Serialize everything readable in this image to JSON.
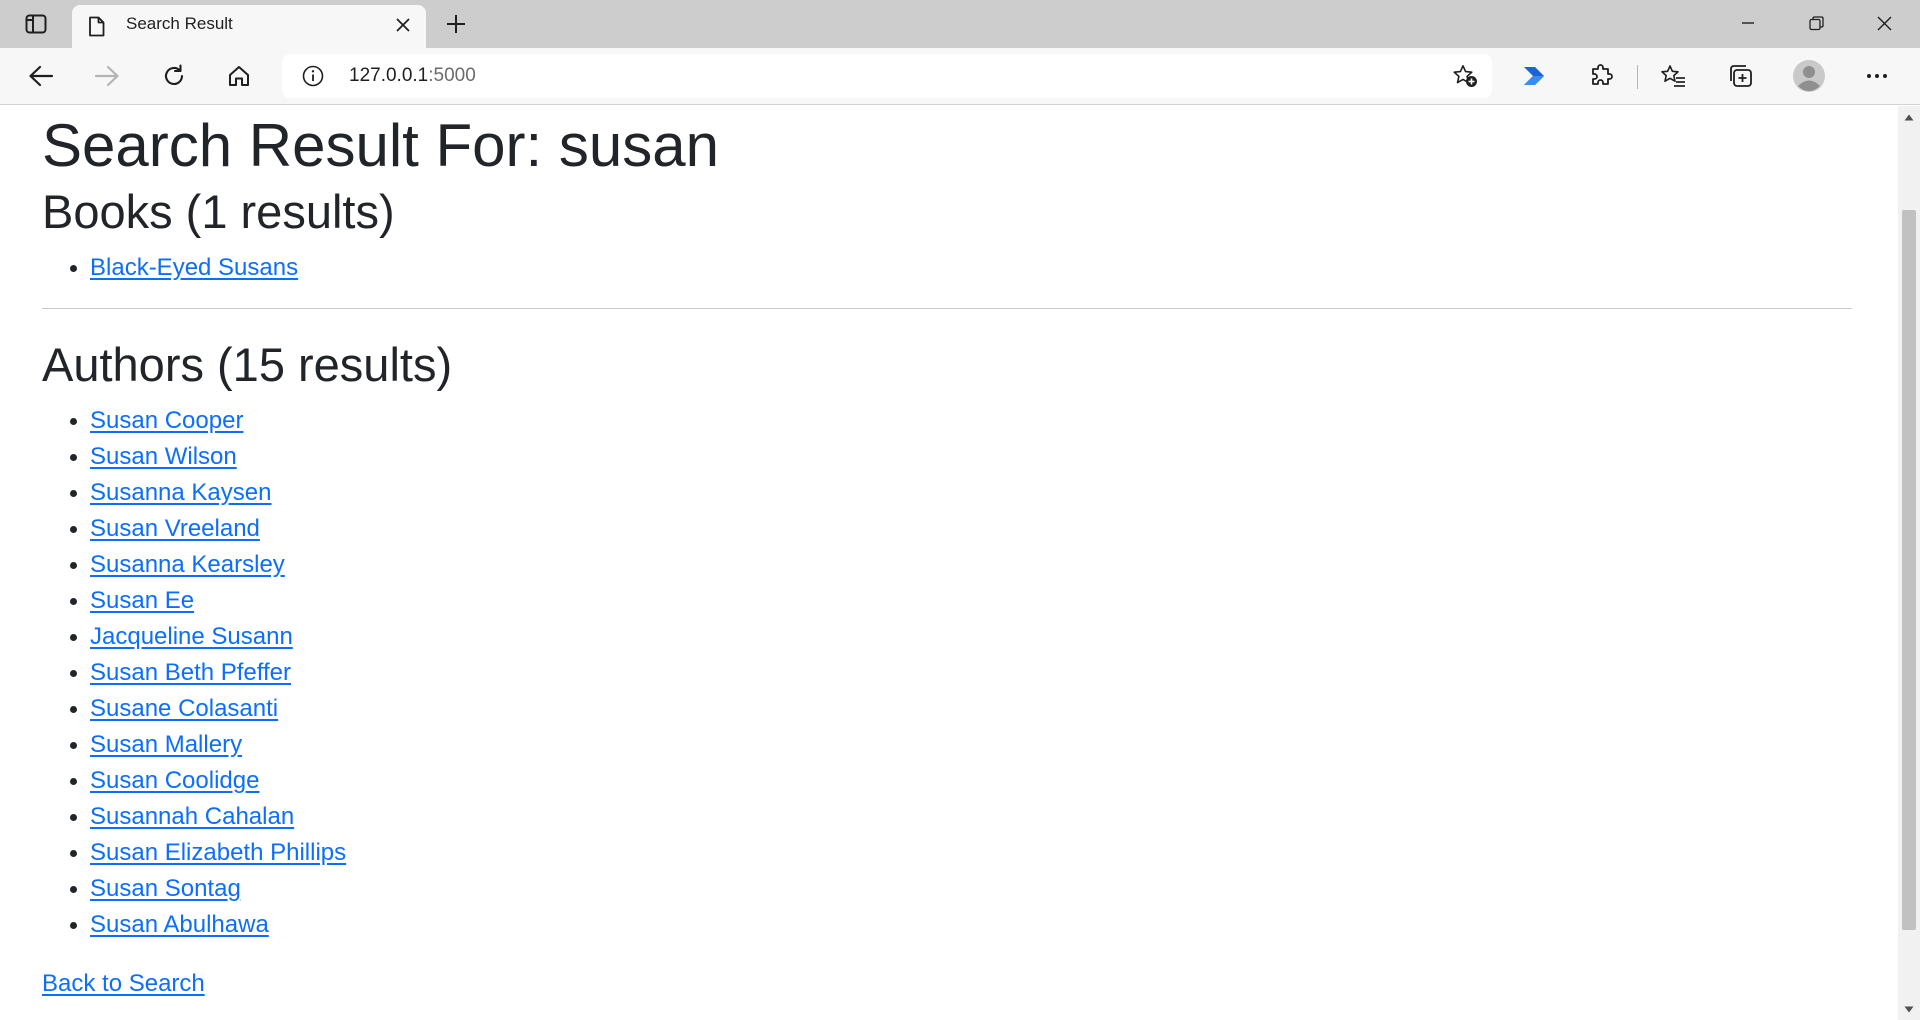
{
  "browser": {
    "tab_title": "Search Result",
    "url_host": "127.0.0.1",
    "url_port": ":5000"
  },
  "page": {
    "title": "Search Result For: susan",
    "books_heading": "Books (1 results)",
    "books": [
      "Black-Eyed Susans"
    ],
    "authors_heading": "Authors (15 results)",
    "authors": [
      "Susan Cooper",
      "Susan Wilson",
      "Susanna Kaysen",
      "Susan Vreeland",
      "Susanna Kearsley",
      "Susan Ee",
      "Jacqueline Susann",
      "Susan Beth Pfeffer",
      "Susane Colasanti",
      "Susan Mallery",
      "Susan Coolidge",
      "Susannah Cahalan",
      "Susan Elizabeth Phillips",
      "Susan Sontag",
      "Susan Abulhawa"
    ],
    "back_link": "Back to Search"
  },
  "colors": {
    "link": "#0d6efd",
    "text": "#212529",
    "chrome_tabstrip": "#cdcdcd",
    "chrome_toolbar": "#f7f7f7"
  }
}
